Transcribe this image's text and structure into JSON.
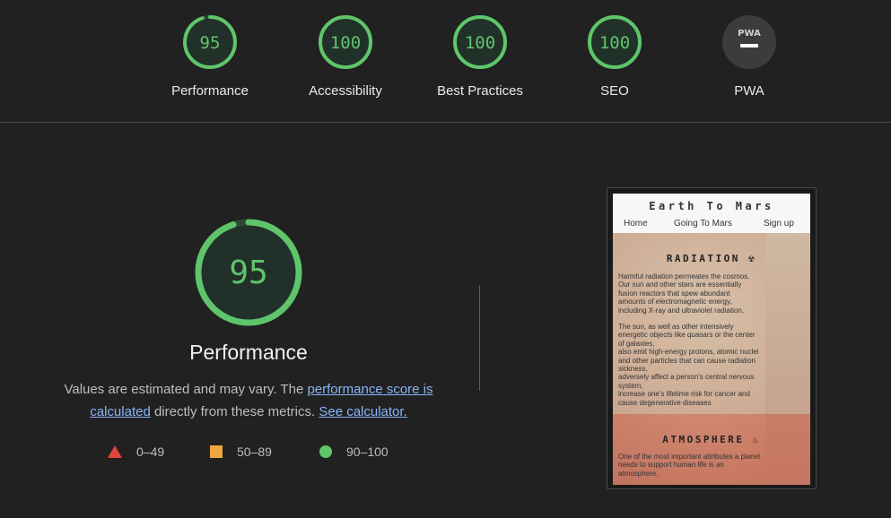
{
  "categories": [
    {
      "label": "Performance",
      "score": "95",
      "value": 95
    },
    {
      "label": "Accessibility",
      "score": "100",
      "value": 100
    },
    {
      "label": "Best Practices",
      "score": "100",
      "value": 100
    },
    {
      "label": "SEO",
      "score": "100",
      "value": 100
    },
    {
      "label": "PWA",
      "badge": "PWA"
    }
  ],
  "colors": {
    "pass": "#5fc56b",
    "average": "#f0a73e",
    "fail": "#e0453b",
    "pwa_bg": "#3c3c3c"
  },
  "main": {
    "score": "95",
    "value": 95,
    "title": "Performance",
    "desc_part1": "Values are estimated and may vary. The ",
    "desc_link1": "performance score is calculated",
    "desc_part2": " directly from these metrics. ",
    "desc_link2": "See calculator."
  },
  "legend": [
    {
      "range": "0–49",
      "icon": "triangle-icon"
    },
    {
      "range": "50–89",
      "icon": "square-icon"
    },
    {
      "range": "90–100",
      "icon": "circle-icon"
    }
  ],
  "thumbnail": {
    "title": "Earth To Mars",
    "nav": [
      "Home",
      "Going To Mars",
      "Sign up"
    ],
    "sections": [
      {
        "heading": "RADIATION",
        "icon": "radiation-icon",
        "lines": [
          "Harmful radiation permeates the cosmos.",
          "Our sun and other stars are essentially",
          "fusion reactors that spew abundant",
          "amounts of electromagnetic energy,",
          "including X-ray and ultraviolet radiation.",
          "",
          "The sun, as well as other intensively",
          "energetic objects like quasars or the center",
          "of galaxies,",
          "also emit high-energy protons, atomic nuclei",
          "and other particles that can cause radiation",
          "sickness,",
          "adversely affect a person's central nervous",
          "system,",
          "increase one's lifetime risk for cancer and",
          "cause degenerative diseases"
        ]
      },
      {
        "heading": "ATMOSPHERE",
        "icon": "smoke-icon",
        "lines": [
          "One of the most important attributes a planet",
          "needs to support human life is an",
          "atmosphere."
        ]
      }
    ]
  }
}
